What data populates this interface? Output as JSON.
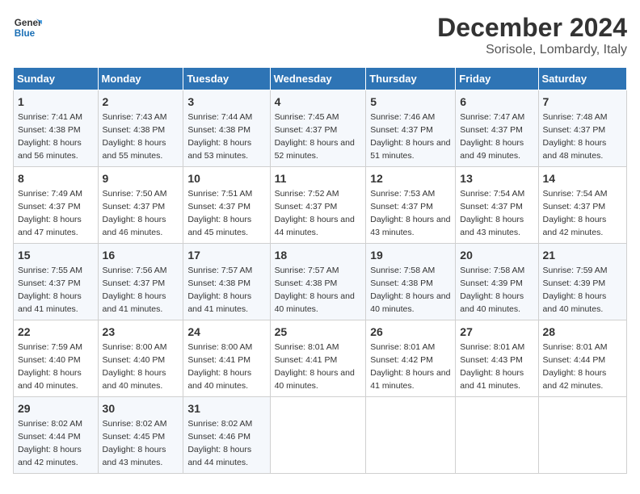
{
  "header": {
    "logo_line1": "General",
    "logo_line2": "Blue",
    "title": "December 2024",
    "subtitle": "Sorisole, Lombardy, Italy"
  },
  "days_of_week": [
    "Sunday",
    "Monday",
    "Tuesday",
    "Wednesday",
    "Thursday",
    "Friday",
    "Saturday"
  ],
  "weeks": [
    [
      {
        "day": "1",
        "sunrise": "7:41 AM",
        "sunset": "4:38 PM",
        "daylight": "8 hours and 56 minutes."
      },
      {
        "day": "2",
        "sunrise": "7:43 AM",
        "sunset": "4:38 PM",
        "daylight": "8 hours and 55 minutes."
      },
      {
        "day": "3",
        "sunrise": "7:44 AM",
        "sunset": "4:38 PM",
        "daylight": "8 hours and 53 minutes."
      },
      {
        "day": "4",
        "sunrise": "7:45 AM",
        "sunset": "4:37 PM",
        "daylight": "8 hours and 52 minutes."
      },
      {
        "day": "5",
        "sunrise": "7:46 AM",
        "sunset": "4:37 PM",
        "daylight": "8 hours and 51 minutes."
      },
      {
        "day": "6",
        "sunrise": "7:47 AM",
        "sunset": "4:37 PM",
        "daylight": "8 hours and 49 minutes."
      },
      {
        "day": "7",
        "sunrise": "7:48 AM",
        "sunset": "4:37 PM",
        "daylight": "8 hours and 48 minutes."
      }
    ],
    [
      {
        "day": "8",
        "sunrise": "7:49 AM",
        "sunset": "4:37 PM",
        "daylight": "8 hours and 47 minutes."
      },
      {
        "day": "9",
        "sunrise": "7:50 AM",
        "sunset": "4:37 PM",
        "daylight": "8 hours and 46 minutes."
      },
      {
        "day": "10",
        "sunrise": "7:51 AM",
        "sunset": "4:37 PM",
        "daylight": "8 hours and 45 minutes."
      },
      {
        "day": "11",
        "sunrise": "7:52 AM",
        "sunset": "4:37 PM",
        "daylight": "8 hours and 44 minutes."
      },
      {
        "day": "12",
        "sunrise": "7:53 AM",
        "sunset": "4:37 PM",
        "daylight": "8 hours and 43 minutes."
      },
      {
        "day": "13",
        "sunrise": "7:54 AM",
        "sunset": "4:37 PM",
        "daylight": "8 hours and 43 minutes."
      },
      {
        "day": "14",
        "sunrise": "7:54 AM",
        "sunset": "4:37 PM",
        "daylight": "8 hours and 42 minutes."
      }
    ],
    [
      {
        "day": "15",
        "sunrise": "7:55 AM",
        "sunset": "4:37 PM",
        "daylight": "8 hours and 41 minutes."
      },
      {
        "day": "16",
        "sunrise": "7:56 AM",
        "sunset": "4:37 PM",
        "daylight": "8 hours and 41 minutes."
      },
      {
        "day": "17",
        "sunrise": "7:57 AM",
        "sunset": "4:38 PM",
        "daylight": "8 hours and 41 minutes."
      },
      {
        "day": "18",
        "sunrise": "7:57 AM",
        "sunset": "4:38 PM",
        "daylight": "8 hours and 40 minutes."
      },
      {
        "day": "19",
        "sunrise": "7:58 AM",
        "sunset": "4:38 PM",
        "daylight": "8 hours and 40 minutes."
      },
      {
        "day": "20",
        "sunrise": "7:58 AM",
        "sunset": "4:39 PM",
        "daylight": "8 hours and 40 minutes."
      },
      {
        "day": "21",
        "sunrise": "7:59 AM",
        "sunset": "4:39 PM",
        "daylight": "8 hours and 40 minutes."
      }
    ],
    [
      {
        "day": "22",
        "sunrise": "7:59 AM",
        "sunset": "4:40 PM",
        "daylight": "8 hours and 40 minutes."
      },
      {
        "day": "23",
        "sunrise": "8:00 AM",
        "sunset": "4:40 PM",
        "daylight": "8 hours and 40 minutes."
      },
      {
        "day": "24",
        "sunrise": "8:00 AM",
        "sunset": "4:41 PM",
        "daylight": "8 hours and 40 minutes."
      },
      {
        "day": "25",
        "sunrise": "8:01 AM",
        "sunset": "4:41 PM",
        "daylight": "8 hours and 40 minutes."
      },
      {
        "day": "26",
        "sunrise": "8:01 AM",
        "sunset": "4:42 PM",
        "daylight": "8 hours and 41 minutes."
      },
      {
        "day": "27",
        "sunrise": "8:01 AM",
        "sunset": "4:43 PM",
        "daylight": "8 hours and 41 minutes."
      },
      {
        "day": "28",
        "sunrise": "8:01 AM",
        "sunset": "4:44 PM",
        "daylight": "8 hours and 42 minutes."
      }
    ],
    [
      {
        "day": "29",
        "sunrise": "8:02 AM",
        "sunset": "4:44 PM",
        "daylight": "8 hours and 42 minutes."
      },
      {
        "day": "30",
        "sunrise": "8:02 AM",
        "sunset": "4:45 PM",
        "daylight": "8 hours and 43 minutes."
      },
      {
        "day": "31",
        "sunrise": "8:02 AM",
        "sunset": "4:46 PM",
        "daylight": "8 hours and 44 minutes."
      },
      null,
      null,
      null,
      null
    ]
  ],
  "labels": {
    "sunrise": "Sunrise:",
    "sunset": "Sunset:",
    "daylight": "Daylight:"
  }
}
